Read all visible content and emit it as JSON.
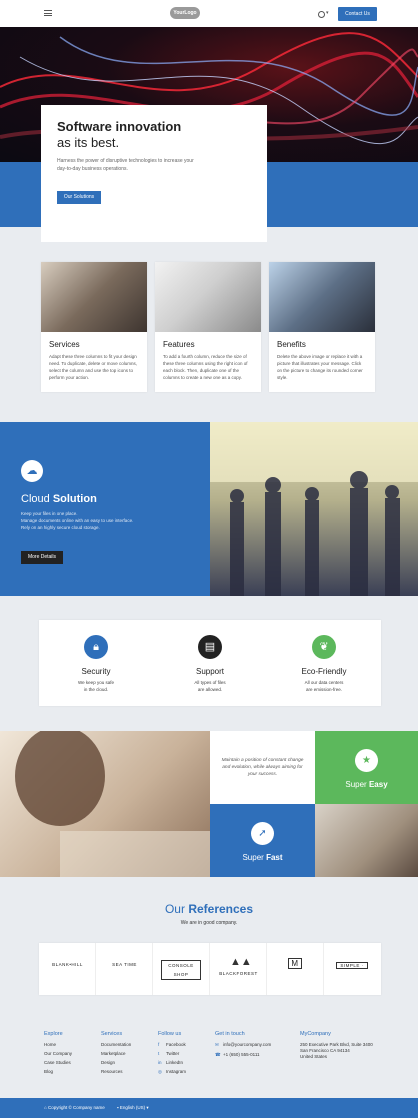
{
  "header": {
    "logo_text": "YourLogo",
    "contact_label": "Contact Us",
    "user_caret": "▾"
  },
  "hero": {
    "title": "Software innovation",
    "subtitle": "as its best.",
    "description": "Harness the power of disruptive technologies to increase your day-to-day business operations.",
    "button_label": "Our Solutions"
  },
  "cards": [
    {
      "title": "Services",
      "text": "Adapt these three columns to fit your design need. To duplicate, delete or move columns, select the column and use the top icons to perform your action."
    },
    {
      "title": "Features",
      "text": "To add a fourth column, reduce the size of these three columns using the right icon of each block. Then, duplicate one of the columns to create a new one as a copy."
    },
    {
      "title": "Benefits",
      "text": "Delete the above image or replace it with a picture that illustrates your message. Click on the picture to change its rounded corner style."
    }
  ],
  "cloud": {
    "title_light": "Cloud",
    "title_bold": "Solution",
    "lines": [
      "Keep your files in one place.",
      "Manage documents online with an easy to use interface.",
      "Rely on an highly secure cloud storage."
    ],
    "button_label": "More Details"
  },
  "features": [
    {
      "title": "Security",
      "line1": "We keep you safe",
      "line2": "in the cloud.",
      "color": "#2f6fba",
      "icon": "lock-icon"
    },
    {
      "title": "Support",
      "line1": "All types of files",
      "line2": "are allowed.",
      "color": "#222222",
      "icon": "file-icon"
    },
    {
      "title": "Eco-Friendly",
      "line1": "All our data centers",
      "line2": "are emission-free.",
      "color": "#5cb85c",
      "icon": "leaf-icon"
    }
  ],
  "mosaic": {
    "quote": "Maintain a position of constant change and evolution, while always aiming for your success.",
    "easy_light": "Super",
    "easy_bold": "Easy",
    "fast_light": "Super",
    "fast_bold": "Fast"
  },
  "references": {
    "title_light": "Our",
    "title_bold": "References",
    "subtitle": "We are in good company.",
    "logos": [
      "BLANK•HILL",
      "SEA TIME",
      "CONSOLE SHOP",
      "BLACKFOREST",
      "M",
      "SIMPLE ·"
    ]
  },
  "footer": {
    "explore": {
      "heading": "Explore",
      "items": [
        "Home",
        "Our Company",
        "Case Studies",
        "Blog"
      ]
    },
    "services": {
      "heading": "Services",
      "items": [
        "Documentation",
        "Marketplace",
        "Design",
        "Resources"
      ]
    },
    "follow": {
      "heading": "Follow us",
      "items": [
        "Facebook",
        "Twitter",
        "LinkedIn",
        "Instagram"
      ]
    },
    "touch": {
      "heading": "Get in touch",
      "items": [
        "info@yourcompany.com",
        "+1 (650) 555-0111"
      ]
    },
    "company": {
      "heading": "MyCompany",
      "items": [
        "250 Executive Park Blvd, Suite 3400",
        "San Francisco CA 94134",
        "United States"
      ]
    }
  },
  "bottom": {
    "copyright": "Copyright © Company name",
    "language": "English (US)"
  },
  "colors": {
    "accent": "#2f6fba",
    "green": "#5cb85c"
  }
}
